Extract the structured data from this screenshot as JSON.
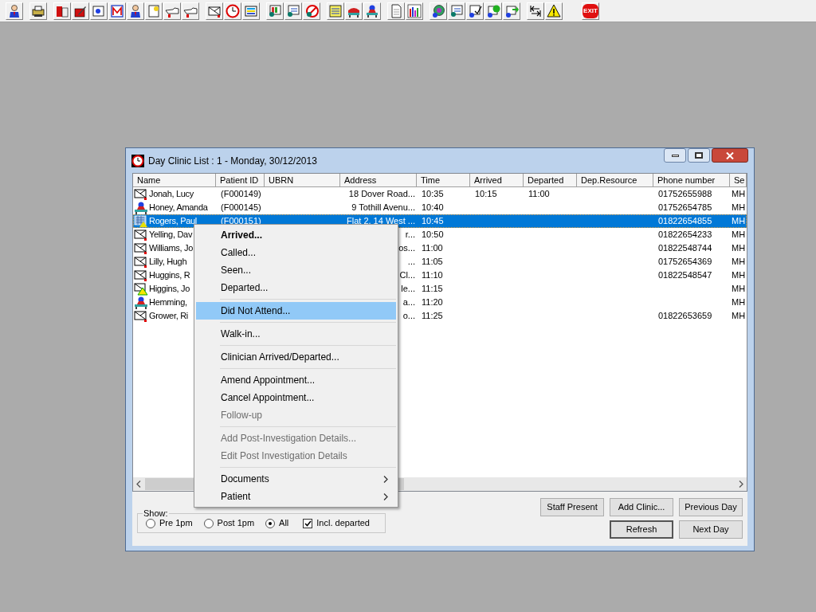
{
  "toolbar": {
    "exit_label": "EXIT"
  },
  "window": {
    "title": "Day Clinic List : 1 - Monday, 30/12/2013",
    "table": {
      "columns": [
        {
          "label": "Name"
        },
        {
          "label": "Patient ID"
        },
        {
          "label": "UBRN"
        },
        {
          "label": "Address"
        },
        {
          "label": "Time"
        },
        {
          "label": "Arrived"
        },
        {
          "label": "Departed"
        },
        {
          "label": "Dep.Resource"
        },
        {
          "label": "Phone number"
        },
        {
          "label": "Se"
        }
      ],
      "rows": [
        {
          "kind": "letter",
          "selected": false,
          "name": "Jonah, Lucy",
          "patient_id": "(F000149)",
          "address": "18 Dover Road...",
          "time": "10:35",
          "arrived": "10:15",
          "departed": "11:00",
          "phone": "01752655988",
          "session": "MH"
        },
        {
          "kind": "bed",
          "selected": false,
          "name": "Honey, Amanda",
          "patient_id": "(F000145)",
          "address": "9 Tothill Avenu...",
          "time": "10:40",
          "phone": "01752654785",
          "session": "MH"
        },
        {
          "kind": "grid",
          "selected": true,
          "name": "Rogers, Paul",
          "patient_id": "(F000151)",
          "address": "Flat 2, 14 West ...",
          "time": "10:45",
          "phone": "01822654855",
          "session": "MH"
        },
        {
          "kind": "letter",
          "selected": false,
          "name": "Yelling, Dav",
          "address": "r...",
          "time": "10:50",
          "phone": "01822654233",
          "session": "MH"
        },
        {
          "kind": "letter",
          "selected": false,
          "name": "Williams, Jo",
          "address": "os...",
          "time": "11:00",
          "phone": "01822548744",
          "session": "MH"
        },
        {
          "kind": "letter",
          "selected": false,
          "name": "Lilly, Hugh",
          "address": "...",
          "time": "11:05",
          "phone": "01752654369",
          "session": "MH"
        },
        {
          "kind": "letter",
          "selected": false,
          "name": "Huggins, R",
          "address": "Cl...",
          "time": "11:10",
          "phone": "01822548547",
          "session": "MH"
        },
        {
          "kind": "alert",
          "selected": false,
          "name": "Higgins, Jo",
          "address": "le...",
          "time": "11:15",
          "session": "MH"
        },
        {
          "kind": "bed",
          "selected": false,
          "name": "Hemming,",
          "address": "a...",
          "time": "11:20",
          "session": "MH"
        },
        {
          "kind": "letter",
          "selected": false,
          "name": "Grower, Ri",
          "address": "o...",
          "time": "11:25",
          "phone": "01822653659",
          "session": "MH"
        }
      ]
    },
    "show": {
      "label": "Show:",
      "options": [
        {
          "label": "Pre 1pm",
          "selected": false
        },
        {
          "label": "Post 1pm",
          "selected": false
        },
        {
          "label": "All",
          "selected": true
        }
      ],
      "include_departed": {
        "label": "Incl. departed",
        "checked": true
      }
    },
    "button_rows": [
      [
        {
          "label": "Staff Present",
          "default": false
        },
        {
          "label": "Add Clinic...",
          "default": false
        },
        {
          "label": "Previous Day",
          "default": false
        }
      ],
      [
        {
          "label": "Refresh",
          "default": true
        },
        {
          "label": "Next Day",
          "default": false
        }
      ]
    ]
  },
  "context_menu": {
    "groups": [
      [
        {
          "label": "Arrived...",
          "default": true,
          "selected": false,
          "disabled": false,
          "submenu": false
        },
        {
          "label": "Called...",
          "default": false,
          "selected": false,
          "disabled": false,
          "submenu": false
        },
        {
          "label": "Seen...",
          "default": false,
          "selected": false,
          "disabled": false,
          "submenu": false
        },
        {
          "label": "Departed...",
          "default": false,
          "selected": false,
          "disabled": false,
          "submenu": false
        }
      ],
      [
        {
          "label": "Did Not Attend...",
          "default": false,
          "selected": true,
          "disabled": false,
          "submenu": false
        }
      ],
      [
        {
          "label": "Walk-in...",
          "default": false,
          "selected": false,
          "disabled": false,
          "submenu": false
        }
      ],
      [
        {
          "label": "Clinician Arrived/Departed...",
          "default": false,
          "selected": false,
          "disabled": false,
          "submenu": false
        }
      ],
      [
        {
          "label": "Amend Appointment...",
          "default": false,
          "selected": false,
          "disabled": false,
          "submenu": false
        },
        {
          "label": "Cancel Appointment...",
          "default": false,
          "selected": false,
          "disabled": false,
          "submenu": false
        },
        {
          "label": "Follow-up",
          "default": false,
          "selected": false,
          "disabled": true,
          "submenu": false
        }
      ],
      [
        {
          "label": "Add Post-Investigation Details...",
          "default": false,
          "selected": false,
          "disabled": true,
          "submenu": false
        },
        {
          "label": "Edit Post Investigation Details",
          "default": false,
          "selected": false,
          "disabled": true,
          "submenu": false
        }
      ],
      [
        {
          "label": "Documents",
          "default": false,
          "selected": false,
          "disabled": false,
          "submenu": true
        },
        {
          "label": "Patient",
          "default": false,
          "selected": false,
          "disabled": false,
          "submenu": true
        }
      ]
    ]
  }
}
